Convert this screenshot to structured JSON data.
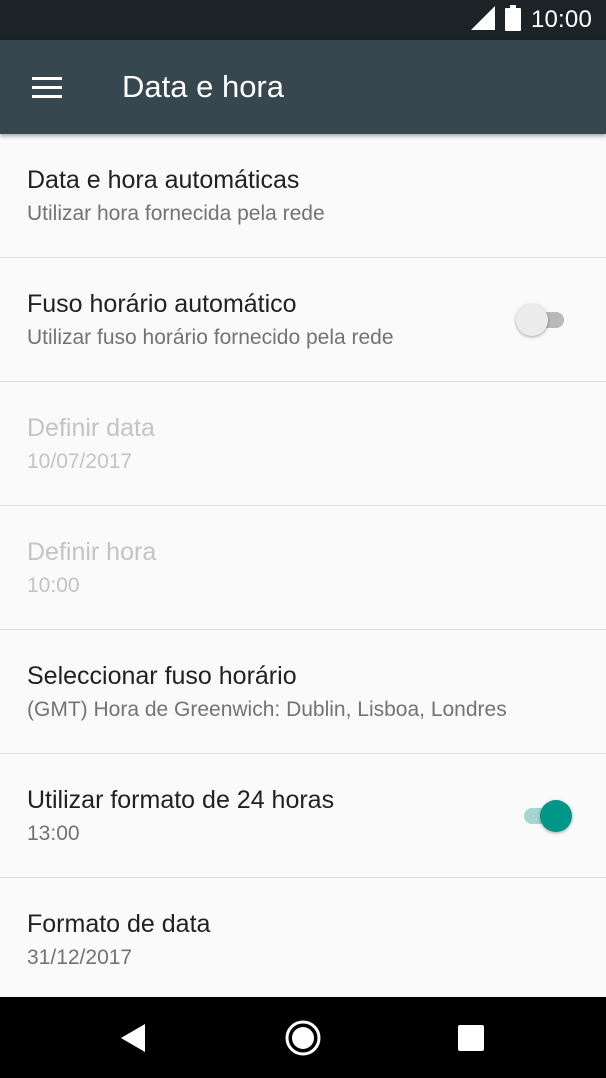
{
  "status_bar": {
    "time": "10:00",
    "icons": [
      "cell-signal-icon",
      "battery-icon"
    ]
  },
  "toolbar": {
    "menu_icon": "hamburger-menu-icon",
    "title": "Data e hora"
  },
  "settings": {
    "auto_datetime": {
      "title": "Data e hora automáticas",
      "subtitle": "Utilizar hora fornecida pela rede"
    },
    "auto_timezone": {
      "title": "Fuso horário automático",
      "subtitle": "Utilizar fuso horário fornecido pela rede",
      "switch_on": false
    },
    "set_date": {
      "title": "Definir data",
      "subtitle": "10/07/2017",
      "disabled": true
    },
    "set_time": {
      "title": "Definir hora",
      "subtitle": "10:00",
      "disabled": true
    },
    "select_timezone": {
      "title": "Seleccionar fuso horário",
      "subtitle": "(GMT) Hora de Greenwich: Dublin, Lisboa, Londres"
    },
    "use_24h": {
      "title": "Utilizar formato de 24 horas",
      "subtitle": "13:00",
      "switch_on": true
    },
    "date_format": {
      "title": "Formato de data",
      "subtitle": "31/12/2017"
    }
  },
  "nav_bar": {
    "buttons": [
      "back-icon",
      "home-icon",
      "recents-icon"
    ]
  },
  "colors": {
    "status_bar": "#1b2326",
    "toolbar": "#37474f",
    "accent": "#009688",
    "background": "#fafafa"
  }
}
